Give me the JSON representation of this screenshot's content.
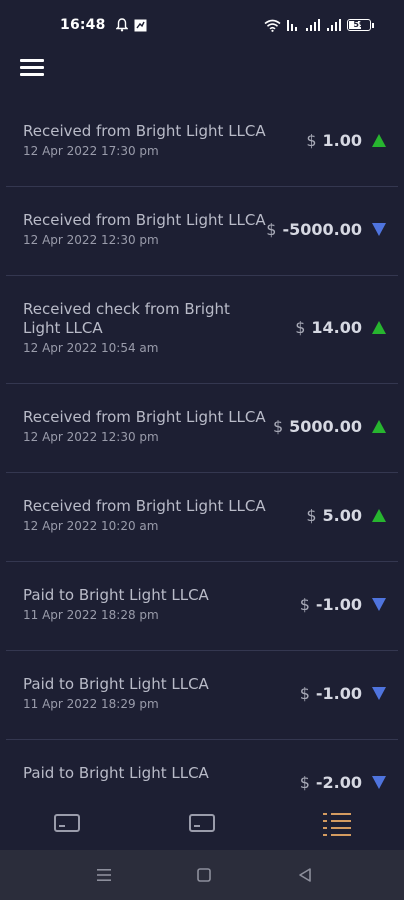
{
  "status_bar": {
    "time": "16:48",
    "battery": "59"
  },
  "header": {
    "menu_icon": "hamburger-menu-icon"
  },
  "colors": {
    "background": "#1d1f33",
    "up_arrow": "#27b52f",
    "down_arrow": "#4f74de",
    "active_nav": "#d49b60"
  },
  "transactions": [
    {
      "title": "Received from Bright Light LLCA",
      "date": "12 Apr 2022 17:30 pm",
      "currency": "$",
      "amount": "1.00",
      "direction": "up"
    },
    {
      "title": "Received from Bright Light LLCA",
      "date": "12 Apr 2022 12:30 pm",
      "currency": "$",
      "amount": "-5000.00",
      "direction": "down"
    },
    {
      "title": "Received check from Bright Light LLCA",
      "date": "12 Apr 2022 10:54 am",
      "currency": "$",
      "amount": "14.00",
      "direction": "up"
    },
    {
      "title": "Received from Bright Light LLCA",
      "date": "12 Apr 2022 12:30 pm",
      "currency": "$",
      "amount": "5000.00",
      "direction": "up"
    },
    {
      "title": "Received from Bright Light LLCA",
      "date": "12 Apr 2022 10:20 am",
      "currency": "$",
      "amount": "5.00",
      "direction": "up"
    },
    {
      "title": "Paid to Bright Light LLCA",
      "date": "11 Apr 2022 18:28 pm",
      "currency": "$",
      "amount": "-1.00",
      "direction": "down"
    },
    {
      "title": "Paid to Bright Light LLCA",
      "date": "11 Apr 2022 18:29 pm",
      "currency": "$",
      "amount": "-1.00",
      "direction": "down"
    },
    {
      "title": "Paid to Bright Light LLCA",
      "date": "",
      "currency": "$",
      "amount": "-2.00",
      "direction": "down"
    }
  ],
  "bottom_nav": {
    "items": [
      {
        "icon": "card-icon",
        "active": false
      },
      {
        "icon": "card-icon",
        "active": false
      },
      {
        "icon": "list-icon",
        "active": true
      }
    ]
  },
  "android_nav": {
    "items": [
      "recents-icon",
      "home-icon",
      "back-icon"
    ]
  }
}
